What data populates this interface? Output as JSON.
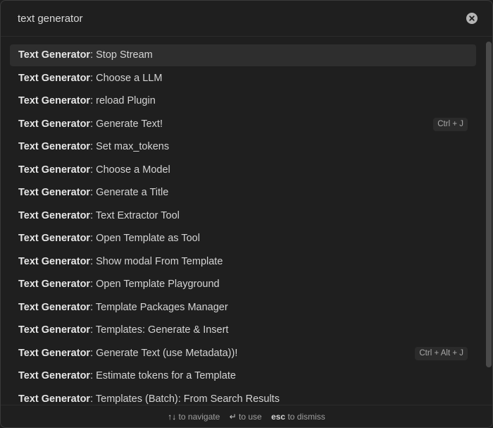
{
  "search": {
    "value": "text generator",
    "placeholder": ""
  },
  "results": [
    {
      "prefix": "Text Generator",
      "label": ": Stop Stream",
      "hotkey": "",
      "selected": true
    },
    {
      "prefix": "Text Generator",
      "label": ": Choose a LLM",
      "hotkey": ""
    },
    {
      "prefix": "Text Generator",
      "label": ": reload Plugin",
      "hotkey": ""
    },
    {
      "prefix": "Text Generator",
      "label": ": Generate Text!",
      "hotkey": "Ctrl + J"
    },
    {
      "prefix": "Text Generator",
      "label": ": Set max_tokens",
      "hotkey": ""
    },
    {
      "prefix": "Text Generator",
      "label": ": Choose a Model",
      "hotkey": ""
    },
    {
      "prefix": "Text Generator",
      "label": ": Generate a Title",
      "hotkey": ""
    },
    {
      "prefix": "Text Generator",
      "label": ": Text Extractor Tool",
      "hotkey": ""
    },
    {
      "prefix": "Text Generator",
      "label": ": Open Template as Tool",
      "hotkey": ""
    },
    {
      "prefix": "Text Generator",
      "label": ": Show modal From Template",
      "hotkey": ""
    },
    {
      "prefix": "Text Generator",
      "label": ": Open Template Playground",
      "hotkey": ""
    },
    {
      "prefix": "Text Generator",
      "label": ": Template Packages Manager",
      "hotkey": ""
    },
    {
      "prefix": "Text Generator",
      "label": ": Templates: Generate & Insert",
      "hotkey": ""
    },
    {
      "prefix": "Text Generator",
      "label": ": Generate Text (use Metadata))!",
      "hotkey": "Ctrl + Alt + J"
    },
    {
      "prefix": "Text Generator",
      "label": ": Estimate tokens for a Template",
      "hotkey": ""
    },
    {
      "prefix": "Text Generator",
      "label": ": Templates (Batch): From Search Results",
      "hotkey": ""
    }
  ],
  "footer": {
    "navigate_key": "↑↓",
    "navigate_label": "to navigate",
    "use_key": "↵",
    "use_label": "to use",
    "dismiss_key": "esc",
    "dismiss_label": "to dismiss"
  },
  "icons": {
    "clear": "close-circle-icon"
  },
  "colors": {
    "background": "#1f1f1f",
    "selected_row": "#2e2e2e",
    "text": "#d4d4d4",
    "hotkey_bg": "#2b2b2b"
  }
}
